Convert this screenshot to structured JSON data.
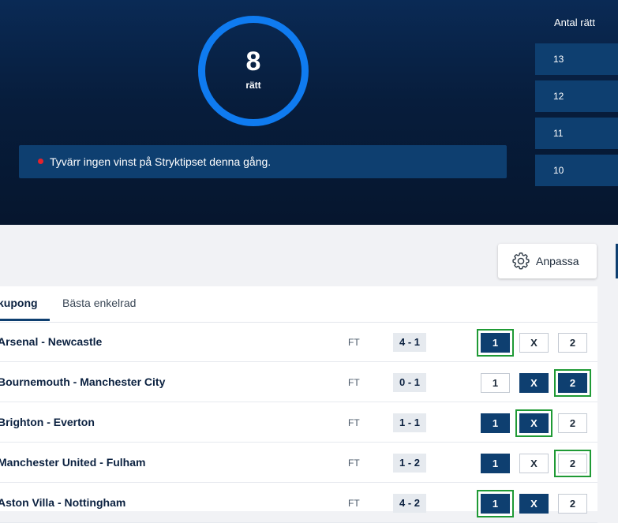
{
  "score": {
    "value": "8",
    "label": "rätt"
  },
  "message": {
    "text": "Tyvärr ingen vinst på Stryktipset denna gång.",
    "dot_color": "#e5222c"
  },
  "antal": {
    "title": "Antal rätt",
    "rows": [
      "13",
      "12",
      "11",
      "10"
    ]
  },
  "settings": {
    "label": "Anpassa",
    "icon": "gear-icon"
  },
  "tabs": [
    {
      "label": "kupong",
      "active": true
    },
    {
      "label": "Bästa enkelrad",
      "active": false
    }
  ],
  "matches": [
    {
      "teams": "Arsenal - Newcastle",
      "status": "FT",
      "result": "4 - 1",
      "options": [
        {
          "label": "1",
          "selected": true,
          "correct": true
        },
        {
          "label": "X",
          "selected": false,
          "correct": false
        },
        {
          "label": "2",
          "selected": false,
          "correct": false
        }
      ]
    },
    {
      "teams": "Bournemouth - Manchester City",
      "status": "FT",
      "result": "0 - 1",
      "options": [
        {
          "label": "1",
          "selected": false,
          "correct": false
        },
        {
          "label": "X",
          "selected": true,
          "correct": false
        },
        {
          "label": "2",
          "selected": true,
          "correct": true
        }
      ]
    },
    {
      "teams": "Brighton - Everton",
      "status": "FT",
      "result": "1 - 1",
      "options": [
        {
          "label": "1",
          "selected": true,
          "correct": false
        },
        {
          "label": "X",
          "selected": true,
          "correct": true
        },
        {
          "label": "2",
          "selected": false,
          "correct": false
        }
      ]
    },
    {
      "teams": "Manchester United - Fulham",
      "status": "FT",
      "result": "1 - 2",
      "options": [
        {
          "label": "1",
          "selected": true,
          "correct": false
        },
        {
          "label": "X",
          "selected": false,
          "correct": false
        },
        {
          "label": "2",
          "selected": false,
          "correct": true
        }
      ]
    },
    {
      "teams": "Aston Villa - Nottingham",
      "status": "FT",
      "result": "4 - 2",
      "options": [
        {
          "label": "1",
          "selected": true,
          "correct": true
        },
        {
          "label": "X",
          "selected": true,
          "correct": false
        },
        {
          "label": "2",
          "selected": false,
          "correct": false
        }
      ]
    }
  ],
  "colors": {
    "primary": "#0e3f70",
    "ring": "#0f7bf0",
    "correct_outline": "#1f9a35",
    "hero_bg": "#071d3c"
  }
}
